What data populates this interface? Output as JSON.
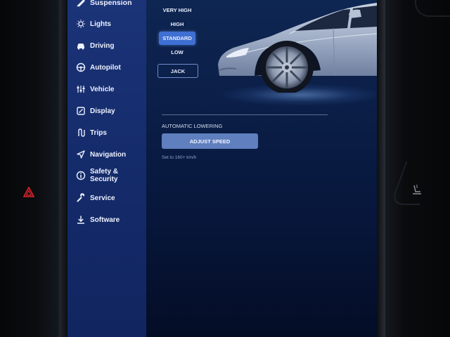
{
  "sidebar": {
    "items": [
      {
        "label": "Suspension",
        "icon": "suspension-icon"
      },
      {
        "label": "Lights",
        "icon": "light-bulb-icon"
      },
      {
        "label": "Driving",
        "icon": "car-icon"
      },
      {
        "label": "Autopilot",
        "icon": "steering-wheel-icon"
      },
      {
        "label": "Vehicle",
        "icon": "sliders-icon"
      },
      {
        "label": "Display",
        "icon": "display-icon"
      },
      {
        "label": "Trips",
        "icon": "trips-icon"
      },
      {
        "label": "Navigation",
        "icon": "navigation-arrow-icon"
      },
      {
        "label_line1": "Safety &",
        "label_line2": "Security",
        "icon": "info-circle-icon"
      },
      {
        "label": "Service",
        "icon": "wrench-icon"
      },
      {
        "label": "Software",
        "icon": "download-icon"
      }
    ]
  },
  "suspension": {
    "height_options": [
      "VERY HIGH",
      "HIGH",
      "STANDARD",
      "LOW"
    ],
    "selected": "STANDARD",
    "jack_label": "JACK"
  },
  "automatic_lowering": {
    "section_label": "AUTOMATIC LOWERING",
    "button_label": "ADJUST SPEED",
    "hint": "Set to 160+ km/h"
  },
  "colors": {
    "sidebar": "#1b3478",
    "selected_option": "#3f6fd2",
    "button": "#5f7fbf",
    "hazard": "#e0242b"
  }
}
